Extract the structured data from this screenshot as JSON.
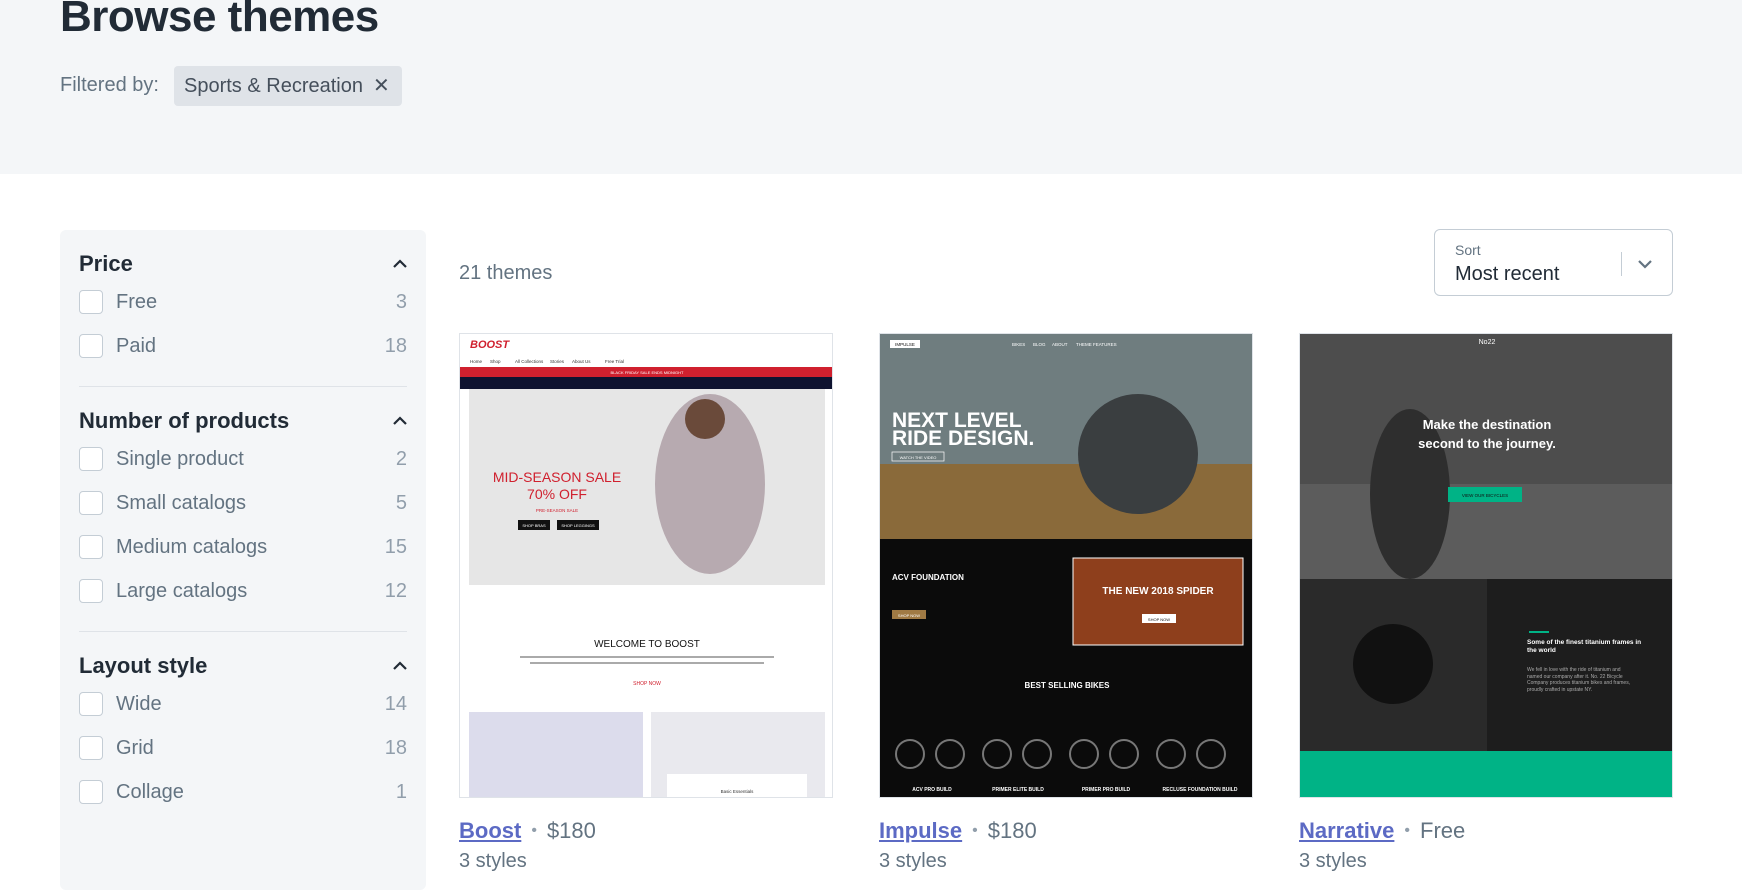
{
  "page": {
    "title": "Browse themes",
    "filtered_by_label": "Filtered by:",
    "active_filter": "Sports & Recreation"
  },
  "sidebar": {
    "sections": [
      {
        "title": "Price",
        "options": [
          {
            "label": "Free",
            "count": "3"
          },
          {
            "label": "Paid",
            "count": "18"
          }
        ]
      },
      {
        "title": "Number of products",
        "options": [
          {
            "label": "Single product",
            "count": "2"
          },
          {
            "label": "Small catalogs",
            "count": "5"
          },
          {
            "label": "Medium catalogs",
            "count": "15"
          },
          {
            "label": "Large catalogs",
            "count": "12"
          }
        ]
      },
      {
        "title": "Layout style",
        "options": [
          {
            "label": "Wide",
            "count": "14"
          },
          {
            "label": "Grid",
            "count": "18"
          },
          {
            "label": "Collage",
            "count": "1"
          }
        ]
      }
    ]
  },
  "results": {
    "count_text": "21 themes",
    "sort_caption": "Sort",
    "sort_value": "Most recent"
  },
  "themes": [
    {
      "name": "Boost",
      "price": "$180",
      "styles": "3 styles",
      "preview": {
        "logo": "BOOST",
        "nav": [
          "Home",
          "Shop",
          "All Collections",
          "Stories",
          "About Us",
          "Free Trial"
        ],
        "banner": "BLACK FRIDAY SALE ENDS MIDNIGHT",
        "headline_1": "MID-SEASON SALE",
        "headline_2": "70% OFF",
        "subhead": "PRE-SEASON SALE",
        "btn_1": "SHOP BRAS",
        "btn_2": "SHOP LEGGINGS",
        "welcome": "WELCOME TO BOOST",
        "welcome_link": "SHOP NOW",
        "tag": "Basic Essentials"
      }
    },
    {
      "name": "Impulse",
      "price": "$180",
      "styles": "3 styles",
      "preview": {
        "logo": "IMPULSE",
        "nav": [
          "BIKES",
          "BLOG",
          "ABOUT",
          "THEME FEATURES"
        ],
        "headline_1": "NEXT LEVEL",
        "headline_2": "RIDE DESIGN.",
        "hero_btn": "WATCH THE VIDEO",
        "promo_1_title": "ACV FOUNDATION",
        "promo_1_btn": "SHOP NOW",
        "promo_2_title": "THE NEW 2018 SPIDER",
        "promo_2_btn": "SHOP NOW",
        "best_title": "BEST SELLING BIKES",
        "bikes": [
          "ACV PRO BUILD",
          "PRIMER ELITE BUILD",
          "PRIMER PRO BUILD",
          "RECLUSE FOUNDATION BUILD"
        ]
      }
    },
    {
      "name": "Narrative",
      "price": "Free",
      "styles": "3 styles",
      "preview": {
        "logo": "No22",
        "headline_1": "Make the destination",
        "headline_2": "second to the journey.",
        "hero_btn": "VIEW OUR BICYCLES",
        "feature_title": "Some of the finest titanium frames in the world",
        "feature_text": "We fell in love with the ride of titanium and named our company after it. No. 22 Bicycle Company produces titanium bikes and frames, proudly crafted in upstate NY."
      }
    }
  ],
  "colors": {
    "hero_bg": "#f4f6f8",
    "link": "#5c6ac4",
    "narrative_accent": "#00b386",
    "boost_accent": "#d0202e"
  }
}
